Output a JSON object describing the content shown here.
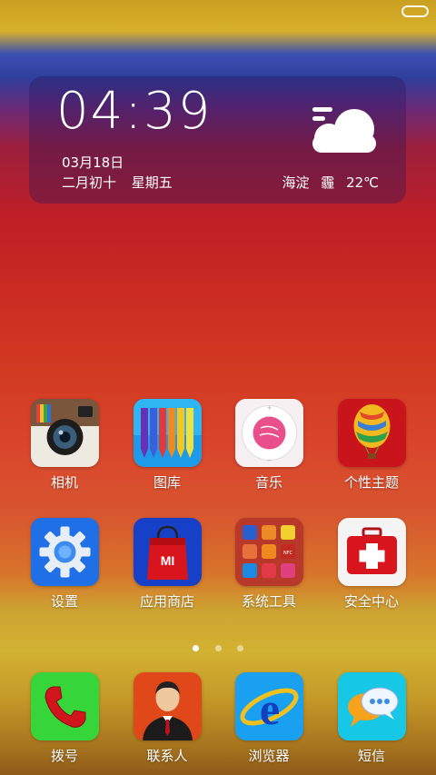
{
  "widget": {
    "time": "04:39",
    "date": "03月18日",
    "lunar_date": "二月初十",
    "weekday": "星期五",
    "location": "海淀",
    "condition": "霾",
    "temperature": "22℃"
  },
  "apps_row1": [
    {
      "label": "相机",
      "icon": "camera-icon"
    },
    {
      "label": "图库",
      "icon": "gallery-pencils-icon"
    },
    {
      "label": "音乐",
      "icon": "music-player-icon"
    },
    {
      "label": "个性主题",
      "icon": "hot-air-balloon-icon"
    }
  ],
  "apps_row2": [
    {
      "label": "设置",
      "icon": "gear-icon"
    },
    {
      "label": "应用商店",
      "icon": "shopping-bag-icon"
    },
    {
      "label": "系统工具",
      "icon": "folder-icon"
    },
    {
      "label": "安全中心",
      "icon": "first-aid-icon"
    }
  ],
  "dock": [
    {
      "label": "拨号",
      "icon": "phone-icon"
    },
    {
      "label": "联系人",
      "icon": "contact-person-icon"
    },
    {
      "label": "浏览器",
      "icon": "browser-e-icon"
    },
    {
      "label": "短信",
      "icon": "message-bubble-icon"
    }
  ],
  "folder_badge": "NFC",
  "store_logo": "MI",
  "page_indicator": {
    "count": 3,
    "active": 1
  }
}
